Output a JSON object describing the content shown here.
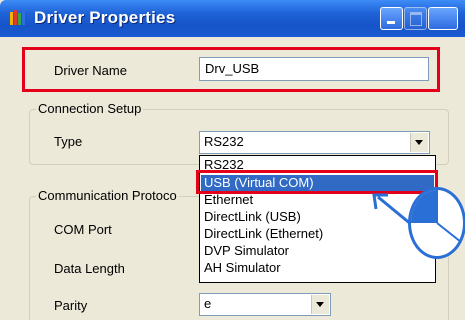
{
  "window": {
    "title": "Driver Properties",
    "accent_color": "#1f63d8",
    "highlight_color": "#e4001b"
  },
  "driver_name": {
    "label": "Driver Name",
    "value": "Drv_USB"
  },
  "connection_setup": {
    "title": "Connection Setup",
    "type_label": "Type",
    "type_value": "RS232",
    "options": [
      "RS232",
      "USB (Virtual COM)",
      "Ethernet",
      "DirectLink (USB)",
      "DirectLink (Ethernet)",
      "DVP Simulator",
      "AH Simulator"
    ],
    "selected_option": "USB (Virtual COM)"
  },
  "communication_protocol": {
    "title": "Communication Protoco",
    "com_port_label": "COM Port",
    "data_length_label": "Data Length",
    "parity_label": "Parity",
    "parity_value": "e"
  },
  "icons": {
    "app": "driver-properties-icon",
    "pointer": "arrow-pointer-icon",
    "mouse": "mouse-icon"
  }
}
